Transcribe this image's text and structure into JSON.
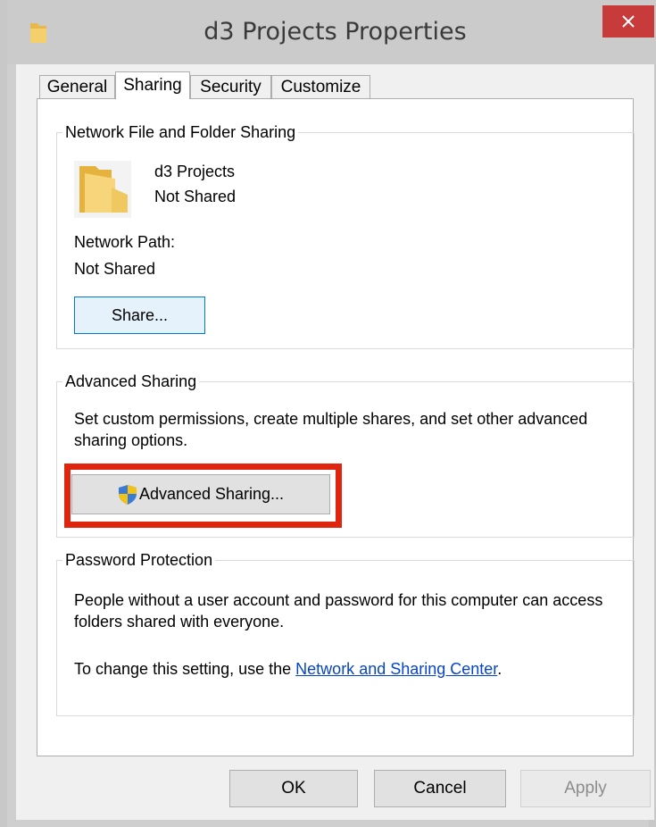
{
  "window": {
    "title": "d3 Projects Properties"
  },
  "tabs": [
    {
      "label": "General",
      "active": false
    },
    {
      "label": "Sharing",
      "active": true
    },
    {
      "label": "Security",
      "active": false
    },
    {
      "label": "Customize",
      "active": false
    }
  ],
  "network_sharing": {
    "group_title": "Network File and Folder Sharing",
    "folder_name": "d3 Projects",
    "folder_status": "Not Shared",
    "path_label": "Network Path:",
    "path_value": "Not Shared",
    "share_button": "Share..."
  },
  "advanced_sharing": {
    "group_title": "Advanced Sharing",
    "description": "Set custom permissions, create multiple shares, and set other advanced sharing options.",
    "button": "Advanced Sharing..."
  },
  "password_protection": {
    "group_title": "Password Protection",
    "description": "People without a user account and password for this computer can access folders shared with everyone.",
    "change_prefix": "To change this setting, use the ",
    "link_text": "Network and Sharing Center",
    "change_suffix": "."
  },
  "footer": {
    "ok": "OK",
    "cancel": "Cancel",
    "apply": "Apply"
  },
  "colors": {
    "highlight": "#e0250f",
    "close": "#c73b3b",
    "link": "#0645c8"
  }
}
